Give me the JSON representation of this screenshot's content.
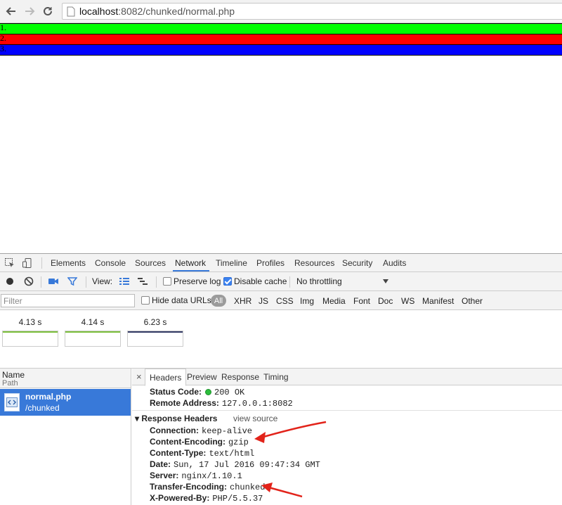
{
  "browser": {
    "url_host": "localhost",
    "url_rest": ":8082/chunked/normal.php"
  },
  "page": {
    "bars": [
      {
        "label": "1.",
        "color": "#00ff00"
      },
      {
        "label": "2.",
        "color": "#ff0000"
      },
      {
        "label": "3.",
        "color": "#0000ff"
      }
    ]
  },
  "devtools": {
    "tabs": [
      "Elements",
      "Console",
      "Sources",
      "Network",
      "Timeline",
      "Profiles",
      "Resources",
      "Security",
      "Audits"
    ],
    "active_tab": "Network",
    "controls": {
      "view_label": "View:",
      "preserve_log": "Preserve log",
      "disable_cache": "Disable cache",
      "throttling": "No throttling"
    },
    "filter": {
      "placeholder": "Filter",
      "hide_data_urls": "Hide data URLs",
      "all": "All",
      "types": [
        "XHR",
        "JS",
        "CSS",
        "Img",
        "Media",
        "Font",
        "Doc",
        "WS",
        "Manifest",
        "Other"
      ]
    },
    "filmstrip": [
      "4.13 s",
      "4.14 s",
      "6.23 s"
    ],
    "list": {
      "name_header": "Name",
      "path_header": "Path",
      "request": {
        "name": "normal.php",
        "path": "/chunked"
      }
    },
    "detail": {
      "tabs": [
        "Headers",
        "Preview",
        "Response",
        "Timing"
      ],
      "status_code_label": "Status Code:",
      "status_code_value": "200 OK",
      "remote_address_label": "Remote Address:",
      "remote_address_value": "127.0.0.1:8082",
      "response_headers_title": "Response Headers",
      "view_source": "view source",
      "headers": [
        {
          "name": "Connection:",
          "value": "keep-alive"
        },
        {
          "name": "Content-Encoding:",
          "value": "gzip"
        },
        {
          "name": "Content-Type:",
          "value": "text/html"
        },
        {
          "name": "Date:",
          "value": "Sun, 17 Jul 2016 09:47:34 GMT"
        },
        {
          "name": "Server:",
          "value": "nginx/1.10.1"
        },
        {
          "name": "Transfer-Encoding:",
          "value": "chunked"
        },
        {
          "name": "X-Powered-By:",
          "value": "PHP/5.5.37"
        }
      ]
    }
  }
}
